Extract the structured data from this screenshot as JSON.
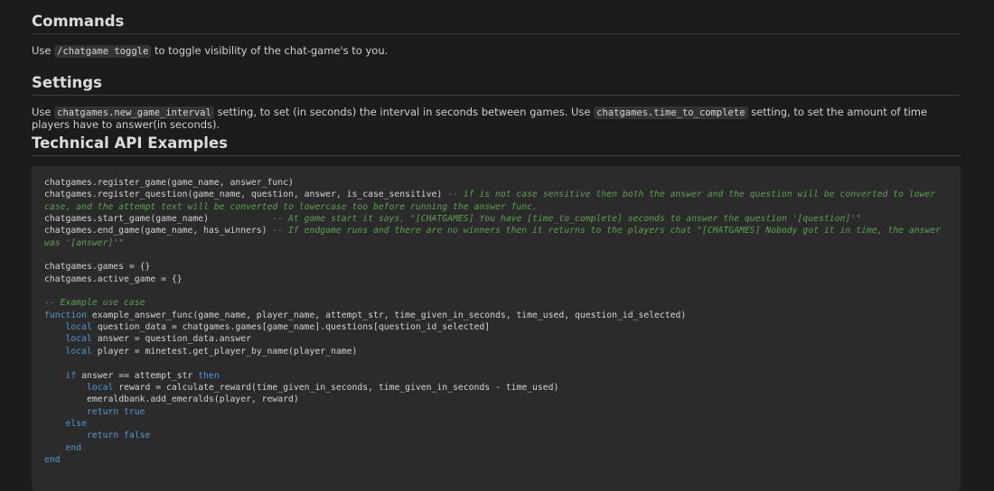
{
  "sections": {
    "commands": {
      "title": "Commands",
      "text_before": "Use ",
      "code": "/chatgame toggle",
      "text_after": " to toggle visibility of the chat-game's to you."
    },
    "settings": {
      "title": "Settings",
      "text_1": "Use ",
      "code_1": "chatgames.new_game_interval",
      "text_2": " setting, to set (in seconds) the interval in seconds between games. Use ",
      "code_2": "chatgames.time_to_complete",
      "text_3": " setting, to set the amount of time players have to answer(in seconds)."
    },
    "api": {
      "title": "Technical API Examples"
    }
  },
  "colors": {
    "keyword": "#4f9ad8",
    "comment": "#5ba24f",
    "background": "#1c1c1c",
    "code_background": "#2b2b2b"
  },
  "code_lines": [
    [
      {
        "t": "chatgames.register_game(game_name, answer_func)",
        "c": ""
      }
    ],
    [
      {
        "t": "chatgames.register_question(game_name, question, answer, is_case_sensitive) ",
        "c": ""
      },
      {
        "t": "-- if is not case sensitive then both the answer and the question will be converted to lower case, and the attempt text will be converted to lowercase too before running the answer func.",
        "c": "cm"
      }
    ],
    [
      {
        "t": "chatgames.start_game(game_name)            ",
        "c": ""
      },
      {
        "t": "-- At game start it says, \"[CHATGAMES] You have [time_to_complete] seconds to answer the question '[question]'\"",
        "c": "cm"
      }
    ],
    [
      {
        "t": "chatgames.end_game(game_name, has_winners) ",
        "c": ""
      },
      {
        "t": "-- If endgame runs and there are no winners then it returns to the players chat \"[CHATGAMES] Nobody got it in time, the answer was '[answer]'\"",
        "c": "cm"
      }
    ],
    [],
    [
      {
        "t": "chatgames.games = {}",
        "c": ""
      }
    ],
    [
      {
        "t": "chatgames.active_game = {}",
        "c": ""
      }
    ],
    [],
    [
      {
        "t": "-- Example use case",
        "c": "cm"
      }
    ],
    [
      {
        "t": "function",
        "c": "kw"
      },
      {
        "t": " example_answer_func(game_name, player_name, attempt_str, time_given_in_seconds, time_used, question_id_selected)",
        "c": ""
      }
    ],
    [
      {
        "t": "    ",
        "c": ""
      },
      {
        "t": "local",
        "c": "kw"
      },
      {
        "t": " question_data = chatgames.games[game_name].questions[question_id_selected]",
        "c": ""
      }
    ],
    [
      {
        "t": "    ",
        "c": ""
      },
      {
        "t": "local",
        "c": "kw"
      },
      {
        "t": " answer = question_data.answer",
        "c": ""
      }
    ],
    [
      {
        "t": "    ",
        "c": ""
      },
      {
        "t": "local",
        "c": "kw"
      },
      {
        "t": " player = minetest.get_player_by_name(player_name)",
        "c": ""
      }
    ],
    [],
    [
      {
        "t": "    ",
        "c": ""
      },
      {
        "t": "if",
        "c": "kw"
      },
      {
        "t": " answer == attempt_str ",
        "c": ""
      },
      {
        "t": "then",
        "c": "kw"
      }
    ],
    [
      {
        "t": "        ",
        "c": ""
      },
      {
        "t": "local",
        "c": "kw"
      },
      {
        "t": " reward = calculate_reward(time_given_in_seconds, time_given_in_seconds - time_used)",
        "c": ""
      }
    ],
    [
      {
        "t": "        emeraldbank.add_emeralds(player, reward)",
        "c": ""
      }
    ],
    [
      {
        "t": "        ",
        "c": ""
      },
      {
        "t": "return true",
        "c": "kw"
      }
    ],
    [
      {
        "t": "    ",
        "c": ""
      },
      {
        "t": "else",
        "c": "kw"
      }
    ],
    [
      {
        "t": "        ",
        "c": ""
      },
      {
        "t": "return false",
        "c": "kw"
      }
    ],
    [
      {
        "t": "    ",
        "c": ""
      },
      {
        "t": "end",
        "c": "kw"
      }
    ],
    [
      {
        "t": "end",
        "c": "kw"
      }
    ]
  ]
}
